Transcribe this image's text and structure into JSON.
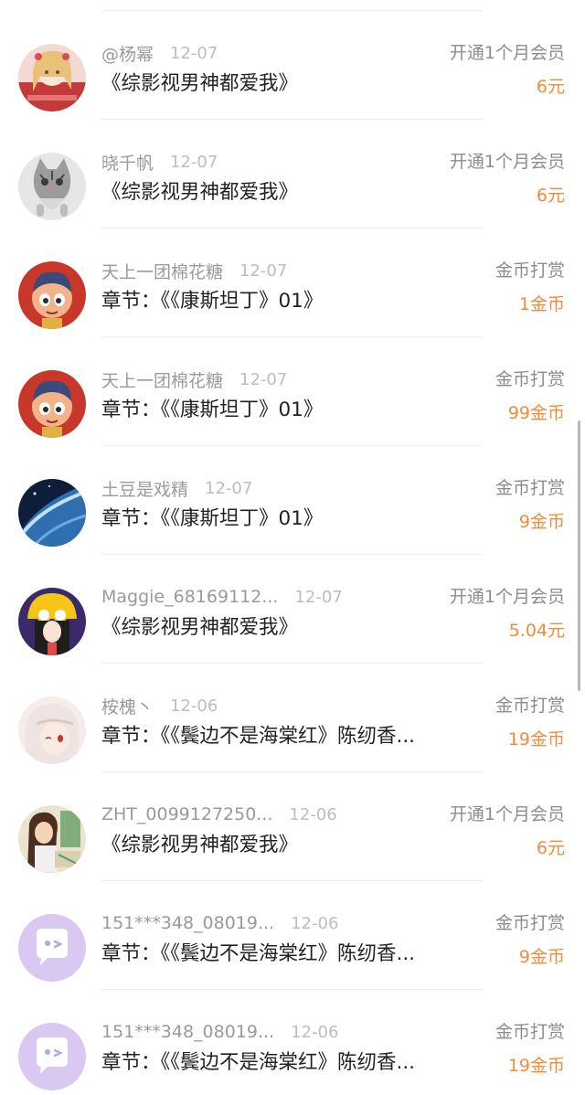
{
  "records": [
    {
      "username": "@杨幂",
      "date": "12-07",
      "title": "《综影视男神都爱我》",
      "type": "开通1个月会员",
      "amount": "6元",
      "avatar": "anime-girl-red"
    },
    {
      "username": "晓千帆",
      "date": "12-07",
      "title": "《综影视男神都爱我》",
      "type": "开通1个月会员",
      "amount": "6元",
      "avatar": "kitten"
    },
    {
      "username": "天上一团棉花糖",
      "date": "12-07",
      "title": "章节：《《康斯坦丁》01》",
      "type": "金币打赏",
      "amount": "1金币",
      "avatar": "cartoon-boy-red"
    },
    {
      "username": "天上一团棉花糖",
      "date": "12-07",
      "title": "章节：《《康斯坦丁》01》",
      "type": "金币打赏",
      "amount": "99金币",
      "avatar": "cartoon-boy-red"
    },
    {
      "username": "土豆是戏精",
      "date": "12-07",
      "title": "章节：《《康斯坦丁》01》",
      "type": "金币打赏",
      "amount": "9金币",
      "avatar": "earth-horizon"
    },
    {
      "username": "Maggie_68169112...",
      "date": "12-07",
      "title": "《综影视男神都爱我》",
      "type": "开通1个月会员",
      "amount": "5.04元",
      "avatar": "girl-yellow-hat"
    },
    {
      "username": "桉槐丶",
      "date": "12-06",
      "title": "章节：《《鬓边不是海棠红》陈纫香...",
      "type": "金币打赏",
      "amount": "19金币",
      "avatar": "anime-girl-white"
    },
    {
      "username": "ZHT_0099127250...",
      "date": "12-06",
      "title": "《综影视男神都爱我》",
      "type": "开通1个月会员",
      "amount": "6元",
      "avatar": "girl-painting"
    },
    {
      "username": "151***348_08019...",
      "date": "12-06",
      "title": "章节：《《鬓边不是海棠红》陈纫香...",
      "type": "金币打赏",
      "amount": "9金币",
      "avatar": "default-chat-purple"
    },
    {
      "username": "151***348_08019...",
      "date": "12-06",
      "title": "章节：《《鬓边不是海棠红》陈纫香...",
      "type": "金币打赏",
      "amount": "19金币",
      "avatar": "default-chat-purple"
    }
  ],
  "colors": {
    "accent_orange": "#f28b3a",
    "secondary_text": "#9a9a9a",
    "date_text": "#bdbdbd",
    "default_avatar_bg": "#d8c8f2"
  }
}
